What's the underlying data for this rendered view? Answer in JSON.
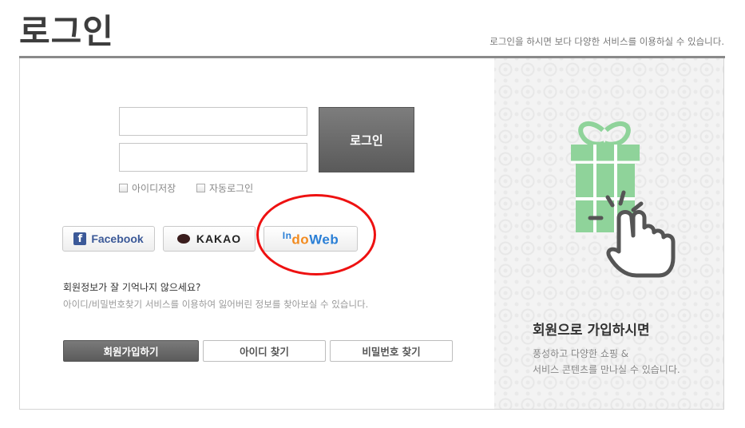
{
  "header": {
    "title": "로그인",
    "description": "로그인을 하시면 보다 다양한 서비스를 이용하실 수 있습니다."
  },
  "login_form": {
    "id_field": {
      "value": "",
      "placeholder": ""
    },
    "password_field": {
      "value": "",
      "placeholder": ""
    },
    "login_button": "로그인",
    "save_id_label": "아이디저장",
    "auto_login_label": "자동로그인"
  },
  "social": {
    "facebook": {
      "icon": "facebook-icon",
      "letter": "f",
      "label": "Facebook",
      "color": "#3b5998"
    },
    "kakao": {
      "icon": "kakao-talk-icon",
      "label": "KAKAO",
      "color": "#3a1d1d"
    },
    "indoweb": {
      "label_parts": [
        "In",
        "do",
        "Web"
      ],
      "colors": [
        "#2a7fd6",
        "#f28a1e",
        "#2a7fd6"
      ]
    }
  },
  "help": {
    "question": "회원정보가 잘 기억나지 않으세요?",
    "hint": "아이디/비밀번호찾기 서비스를 이용하여 잃어버린 정보를 찾아보실 수 있습니다."
  },
  "actions": {
    "signup": "회원가입하기",
    "find_id": "아이디 찾기",
    "find_password": "비밀번호 찾기"
  },
  "promo": {
    "icon": "gift-click-icon",
    "title": "회원으로 가입하시면",
    "desc_line1": "풍성하고 다양한 쇼핑 &",
    "desc_line2": "서비스 콘텐츠를 만나실 수 있습니다.",
    "accent_color": "#8fd39a"
  },
  "annotation": {
    "color": "#ee1111"
  }
}
